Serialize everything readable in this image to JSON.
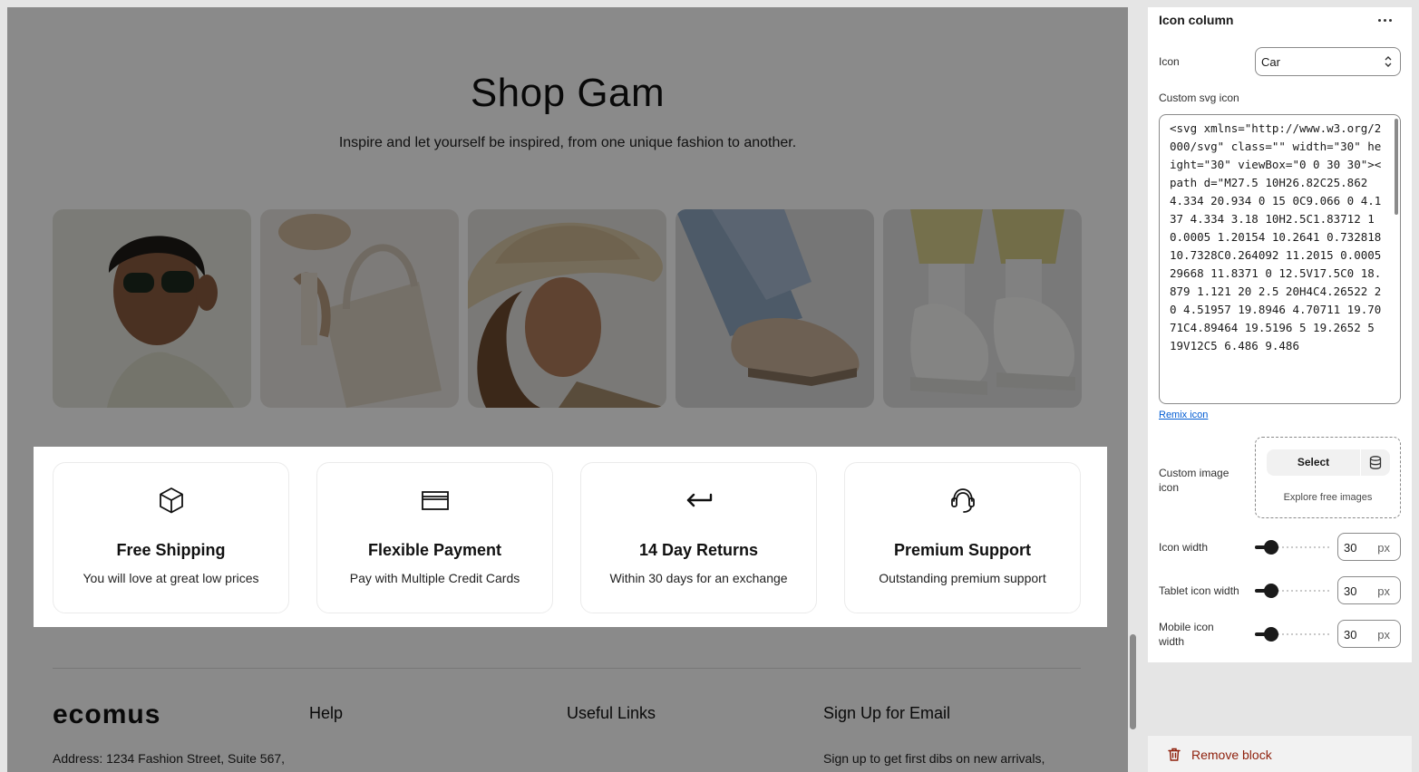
{
  "preview": {
    "title": "Shop Gam",
    "subtitle": "Inspire and let yourself be inspired, from one unique fashion to another.",
    "features": [
      {
        "title": "Free Shipping",
        "desc": "You will love at great low prices",
        "icon": "box-icon"
      },
      {
        "title": "Flexible Payment",
        "desc": "Pay with Multiple Credit Cards",
        "icon": "credit-card-icon"
      },
      {
        "title": "14 Day Returns",
        "desc": "Within 30 days for an exchange",
        "icon": "return-arrow-icon"
      },
      {
        "title": "Premium Support",
        "desc": "Outstanding premium support",
        "icon": "headset-icon"
      }
    ],
    "footer": {
      "logo": "ecomus",
      "col_help": "Help",
      "col_links": "Useful Links",
      "col_signup": "Sign Up for Email",
      "address": "Address: 1234 Fashion Street, Suite 567,",
      "signup_text": "Sign up to get first dibs on new arrivals,"
    }
  },
  "panel": {
    "title": "Icon column",
    "icon_label": "Icon",
    "icon_value": "Car",
    "svg_label": "Custom svg icon",
    "svg_code": "<svg xmlns=\"http://www.w3.org/2000/svg\" class=\"\" width=\"30\" height=\"30\" viewBox=\"0 0 30 30\"><path d=\"M27.5 10H26.82C25.862 4.334 20.934 0 15 0C9.066 0 4.137 4.334 3.18 10H2.5C1.83712 10.0005 1.20154 10.2641 0.732818 10.7328C0.264092 11.2015 0.000529668 11.8371 0 12.5V17.5C0 18.879 1.121 20 2.5 20H4C4.26522 20 4.51957 19.8946 4.70711 19.7071C4.89464 19.5196 5 19.2652 5 19V12C5 6.486 9.486",
    "remix_link": "Remix icon",
    "image_label": "Custom image icon",
    "select_label": "Select",
    "explore_label": "Explore free images",
    "icon_width_label": "Icon width",
    "tablet_width_label": "Tablet icon width",
    "mobile_width_label": "Mobile icon width",
    "icon_width": "30",
    "tablet_width": "30",
    "mobile_width": "30",
    "unit": "px",
    "remove_label": "Remove block"
  },
  "colors": {
    "link": "#005bd3",
    "danger": "#8e1f0b",
    "dim_overlay": "rgba(0,0,0,0.46)"
  }
}
